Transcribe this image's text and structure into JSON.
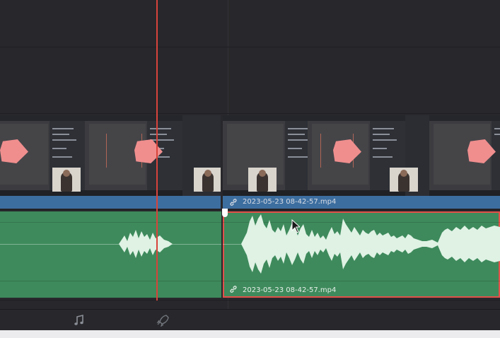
{
  "timeline": {
    "video_clips": [
      {
        "name": "",
        "selected": false
      },
      {
        "name": "2023-05-23 08-42-57.mp4",
        "selected": true
      }
    ],
    "audio_clips": [
      {
        "name": "",
        "selected": false
      },
      {
        "name": "2023-05-23 08-42-57.mp4",
        "selected": true
      }
    ],
    "colors": {
      "video_clip": "#3d6ea0",
      "audio_clip": "#3e8a5c",
      "selection": "#e2514a",
      "playhead": "#d8433b",
      "waveform": "#dff2e4"
    }
  },
  "bottom_toolbar": {
    "tools": [
      {
        "icon": "music-note-icon"
      },
      {
        "icon": "rocket-icon"
      }
    ]
  }
}
